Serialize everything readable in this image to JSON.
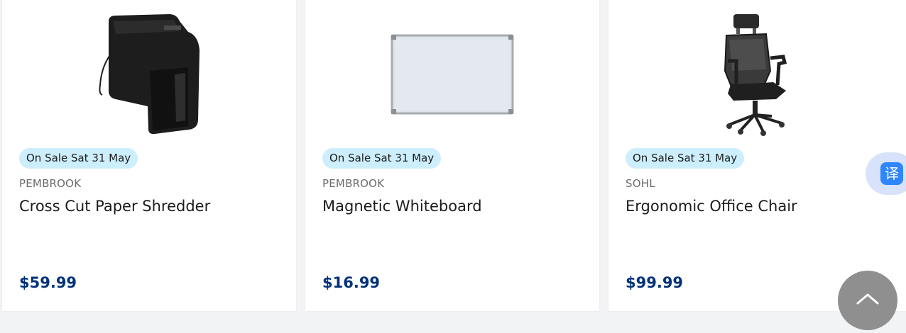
{
  "products": [
    {
      "image": "paper-shredder-image",
      "badge": "On Sale Sat 31 May",
      "brand": "PEMBROOK",
      "title": "Cross Cut Paper Shredder",
      "price": "$59.99"
    },
    {
      "image": "whiteboard-image",
      "badge": "On Sale Sat 31 May",
      "brand": "PEMBROOK",
      "title": "Magnetic Whiteboard",
      "price": "$16.99"
    },
    {
      "image": "office-chair-image",
      "badge": "On Sale Sat 31 May",
      "brand": "SOHL",
      "title": "Ergonomic Office Chair",
      "price": "$99.99"
    }
  ],
  "translate_button": {
    "glyph": "译",
    "icon": "translate-icon"
  },
  "scroll_top_button": {
    "icon": "chevron-up-icon"
  },
  "colors": {
    "badge_bg": "#cdeefc",
    "price": "#00327a",
    "translate_accent": "#2f86ff"
  }
}
